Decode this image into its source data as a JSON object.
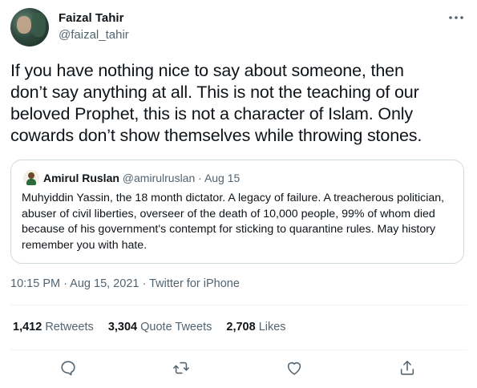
{
  "author": {
    "name": "Faizal Tahir",
    "handle": "@faizal_tahir"
  },
  "tweet": {
    "text": "If you have nothing nice to say about someone, then\ndon’t say anything at all. This is not the teaching of our\nbeloved Prophet, this is not a character of Islam. Only\ncowards don’t show themselves while throwing stones.",
    "time": "10:15 PM",
    "date": "Aug 15, 2021",
    "source": "Twitter for iPhone",
    "sep": " · "
  },
  "quoted": {
    "name": "Amirul Ruslan",
    "handle": "@amirulruslan",
    "date": "Aug 15",
    "meta_sep": " · ",
    "text": "Muhyiddin Yassin, the 18 month dictator. A legacy of failure. A treacherous politician, abuser of civil liberties, overseer of the death of 10,000 people, 99% of whom died because of his government's contempt for sticking to quarantine rules. May history remember you with hate."
  },
  "stats": {
    "retweets_count": "1,412",
    "retweets_label": "Retweets",
    "quotes_count": "3,304",
    "quotes_label": "Quote Tweets",
    "likes_count": "2,708",
    "likes_label": "Likes"
  },
  "icons": {
    "more": "more-horizontal-icon",
    "reply": "reply-icon",
    "retweet": "retweet-icon",
    "like": "heart-icon",
    "share": "share-icon"
  },
  "colors": {
    "text": "#0f1419",
    "secondary": "#536471",
    "border": "#cfd9de",
    "divider": "#eff3f4"
  }
}
